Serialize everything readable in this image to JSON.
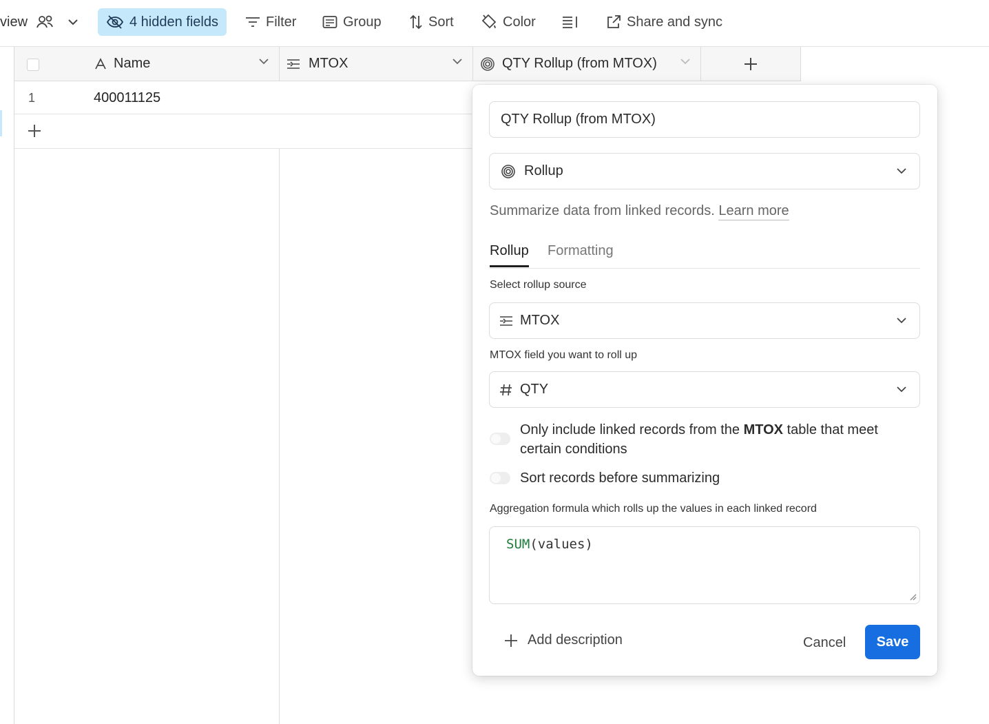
{
  "toolbar": {
    "view_label": "view",
    "hidden_fields_label": "4 hidden fields",
    "filter_label": "Filter",
    "group_label": "Group",
    "sort_label": "Sort",
    "color_label": "Color",
    "share_label": "Share and sync",
    "colors": {
      "hidden_pill_bg": "#c6e8fb"
    }
  },
  "grid": {
    "columns": [
      {
        "name": "Name",
        "icon": "text-a-icon"
      },
      {
        "name": "MTOX",
        "icon": "linked-record-icon"
      },
      {
        "name": "QTY Rollup (from MTOX)",
        "icon": "rollup-icon"
      }
    ],
    "rows": [
      {
        "number": "1",
        "name": "400011125"
      }
    ]
  },
  "popover": {
    "field_name_value": "QTY Rollup (from MTOX)",
    "field_type": "Rollup",
    "description_text": "Summarize data from linked records.",
    "learn_more": "Learn more",
    "tabs": [
      {
        "label": "Rollup",
        "active": true
      },
      {
        "label": "Formatting",
        "active": false
      }
    ],
    "source_label": "Select rollup source",
    "source_value": "MTOX",
    "field_label_prefix": "MTOX",
    "field_label_suffix": "field you want to roll up",
    "field_value": "QTY",
    "toggle1_pre": "Only include linked records from the",
    "toggle1_bold": "MTOX",
    "toggle1_post": "table that meet certain conditions",
    "toggle2": "Sort records before summarizing",
    "aggregation_label": "Aggregation formula which rolls up the values in each linked record",
    "formula_fn": "SUM",
    "formula_args": "(values)",
    "add_description": "Add description",
    "cancel": "Cancel",
    "save": "Save",
    "colors": {
      "save_bg": "#166ee1",
      "formula_fn": "#1e7c3a"
    }
  }
}
